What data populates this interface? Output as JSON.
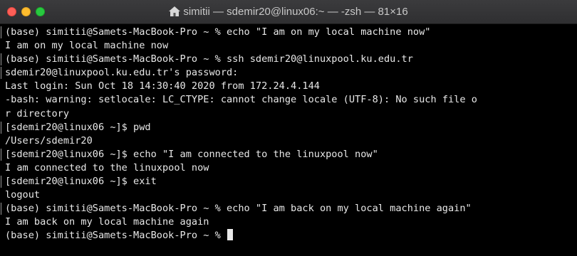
{
  "window": {
    "title": "simitii — sdemir20@linux06:~ — -zsh — 81×16"
  },
  "colors": {
    "background": "#000000",
    "text": "#e8e8e8",
    "close": "#fe5f57",
    "minimize": "#febc2e",
    "zoom": "#28c840"
  },
  "terminal": {
    "lines": [
      {
        "text": "(base) simitii@Samets-MacBook-Pro ~ % echo \"I am on my local machine now\"",
        "mark": true
      },
      {
        "text": "I am on my local machine now",
        "mark": false
      },
      {
        "text": "(base) simitii@Samets-MacBook-Pro ~ % ssh sdemir20@linuxpool.ku.edu.tr",
        "mark": true
      },
      {
        "text": "sdemir20@linuxpool.ku.edu.tr's password:",
        "mark": true
      },
      {
        "text": "Last login: Sun Oct 18 14:30:40 2020 from 172.24.4.144",
        "mark": false
      },
      {
        "text": "-bash: warning: setlocale: LC_CTYPE: cannot change locale (UTF-8): No such file o",
        "mark": false
      },
      {
        "text": "r directory",
        "mark": false
      },
      {
        "text": "[sdemir20@linux06 ~]$ pwd",
        "mark": true
      },
      {
        "text": "/Users/sdemir20",
        "mark": false
      },
      {
        "text": "[sdemir20@linux06 ~]$ echo \"I am connected to the linuxpool now\"",
        "mark": true
      },
      {
        "text": "I am connected to the linuxpool now",
        "mark": false
      },
      {
        "text": "[sdemir20@linux06 ~]$ exit",
        "mark": true
      },
      {
        "text": "logout",
        "mark": false
      },
      {
        "text": "(base) simitii@Samets-MacBook-Pro ~ % echo \"I am back on my local machine again\"",
        "mark": true
      },
      {
        "text": "I am back on my local machine again",
        "mark": false
      },
      {
        "text": "(base) simitii@Samets-MacBook-Pro ~ % ",
        "mark": false
      }
    ]
  }
}
